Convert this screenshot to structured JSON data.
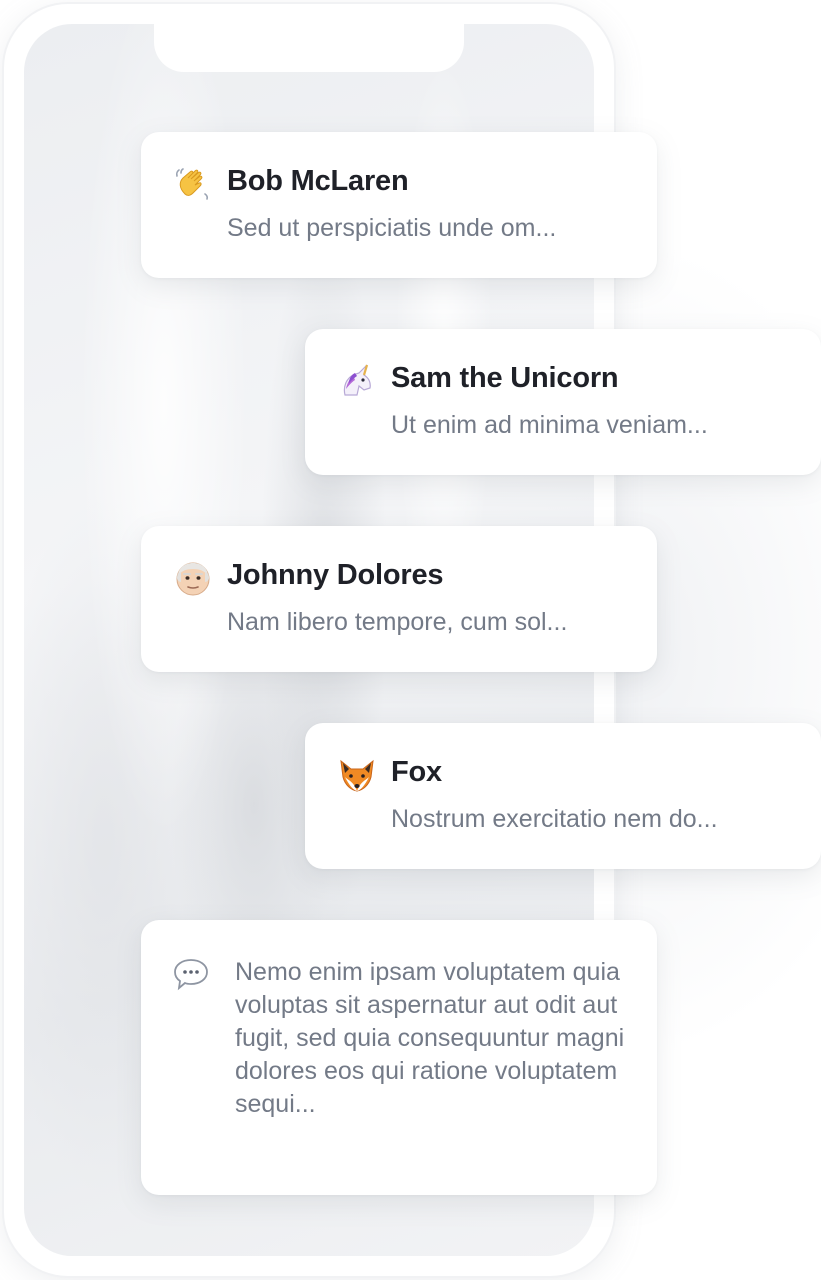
{
  "chats": [
    {
      "name": "Bob McLaren",
      "preview": "Sed ut perspiciatis unde om...",
      "icon": "waving-hand-icon"
    },
    {
      "name": "Sam the Unicorn",
      "preview": "Ut enim ad minima veniam...",
      "icon": "unicorn-icon"
    },
    {
      "name": "Johnny Dolores",
      "preview": "Nam libero tempore, cum sol...",
      "icon": "old-man-icon"
    },
    {
      "name": "Fox",
      "preview": "Nostrum exercitatio nem do...",
      "icon": "fox-icon"
    }
  ],
  "message": {
    "icon": "speech-bubble-icon",
    "text": "Nemo enim ipsam voluptatem quia voluptas sit aspernatur aut odit aut fugit, sed quia consequuntur magni dolores eos qui ratione voluptatem sequi..."
  }
}
